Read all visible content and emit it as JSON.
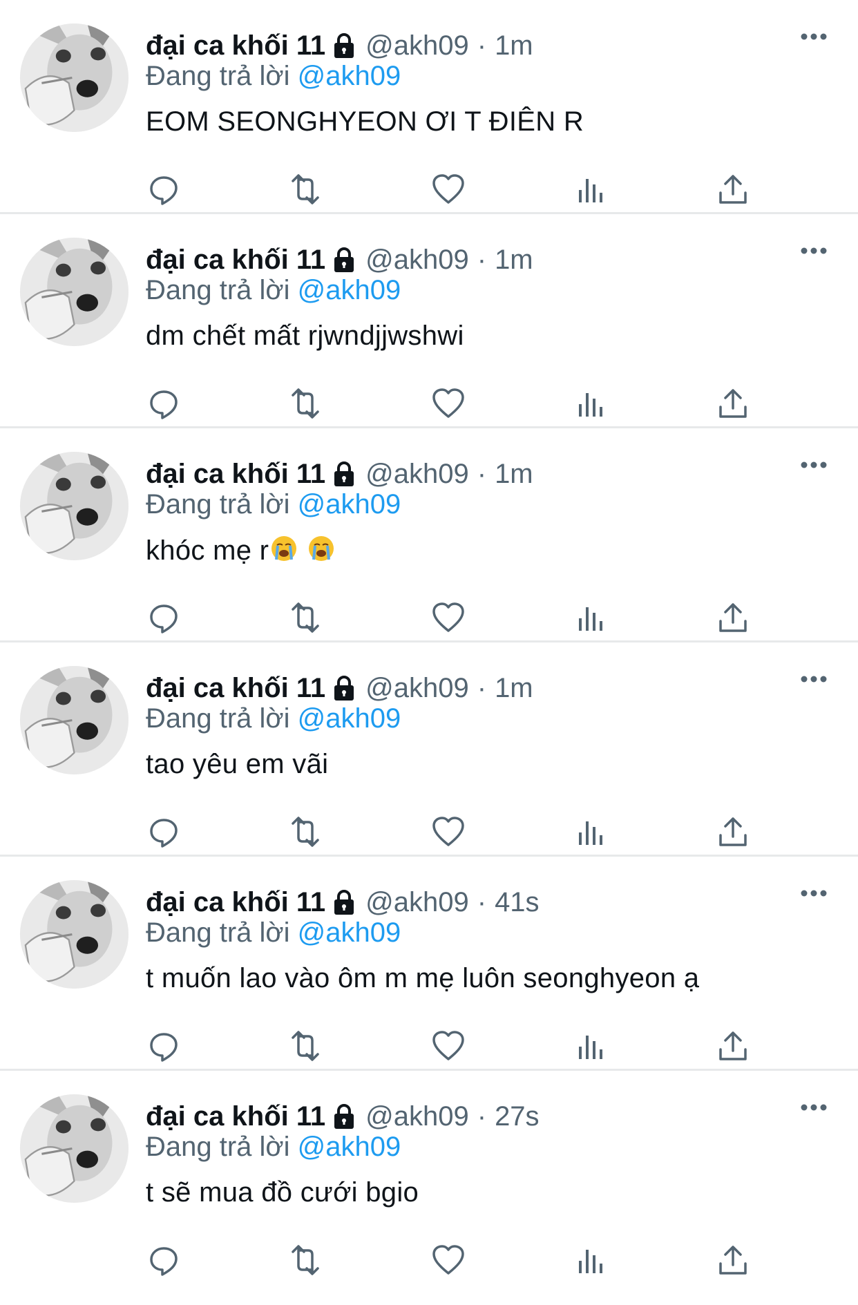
{
  "colors": {
    "text_primary": "#0f1419",
    "text_secondary": "#536471",
    "link": "#1d9bf0",
    "icon": "#536471",
    "divider": "#e7e9ea"
  },
  "icons": {
    "lock": "lock-icon",
    "more": "more-horizontal-icon",
    "reply": "reply-icon",
    "retweet": "retweet-icon",
    "like": "heart-icon",
    "views": "views-icon",
    "share": "share-icon"
  },
  "tweets": [
    {
      "name": "đại ca khối 11",
      "handle": "@akh09",
      "sep": "·",
      "time": "1m",
      "reply_prefix": "Đang trả lời",
      "reply_to": "@akh09",
      "text": "EOM SEONGHYEON ƠI T ĐIÊN R"
    },
    {
      "name": "đại ca khối 11",
      "handle": "@akh09",
      "sep": "·",
      "time": "1m",
      "reply_prefix": "Đang trả lời",
      "reply_to": "@akh09",
      "text": "dm chết mất rjwndjjwshwi"
    },
    {
      "name": "đại ca khối 11",
      "handle": "@akh09",
      "sep": "·",
      "time": "1m",
      "reply_prefix": "Đang trả lời",
      "reply_to": "@akh09",
      "text": "khóc mẹ r",
      "emojis": [
        "loudly-crying-face",
        "loudly-crying-face"
      ]
    },
    {
      "name": "đại ca khối 11",
      "handle": "@akh09",
      "sep": "·",
      "time": "1m",
      "reply_prefix": "Đang trả lời",
      "reply_to": "@akh09",
      "text": "tao yêu em vãi"
    },
    {
      "name": "đại ca khối 11",
      "handle": "@akh09",
      "sep": "·",
      "time": "41s",
      "reply_prefix": "Đang trả lời",
      "reply_to": "@akh09",
      "text": "t muốn lao vào ôm m mẹ luôn seonghyeon ạ"
    },
    {
      "name": "đại ca khối 11",
      "handle": "@akh09",
      "sep": "·",
      "time": "27s",
      "reply_prefix": "Đang trả lời",
      "reply_to": "@akh09",
      "text": "t sẽ mua đồ cưới bgio"
    }
  ]
}
